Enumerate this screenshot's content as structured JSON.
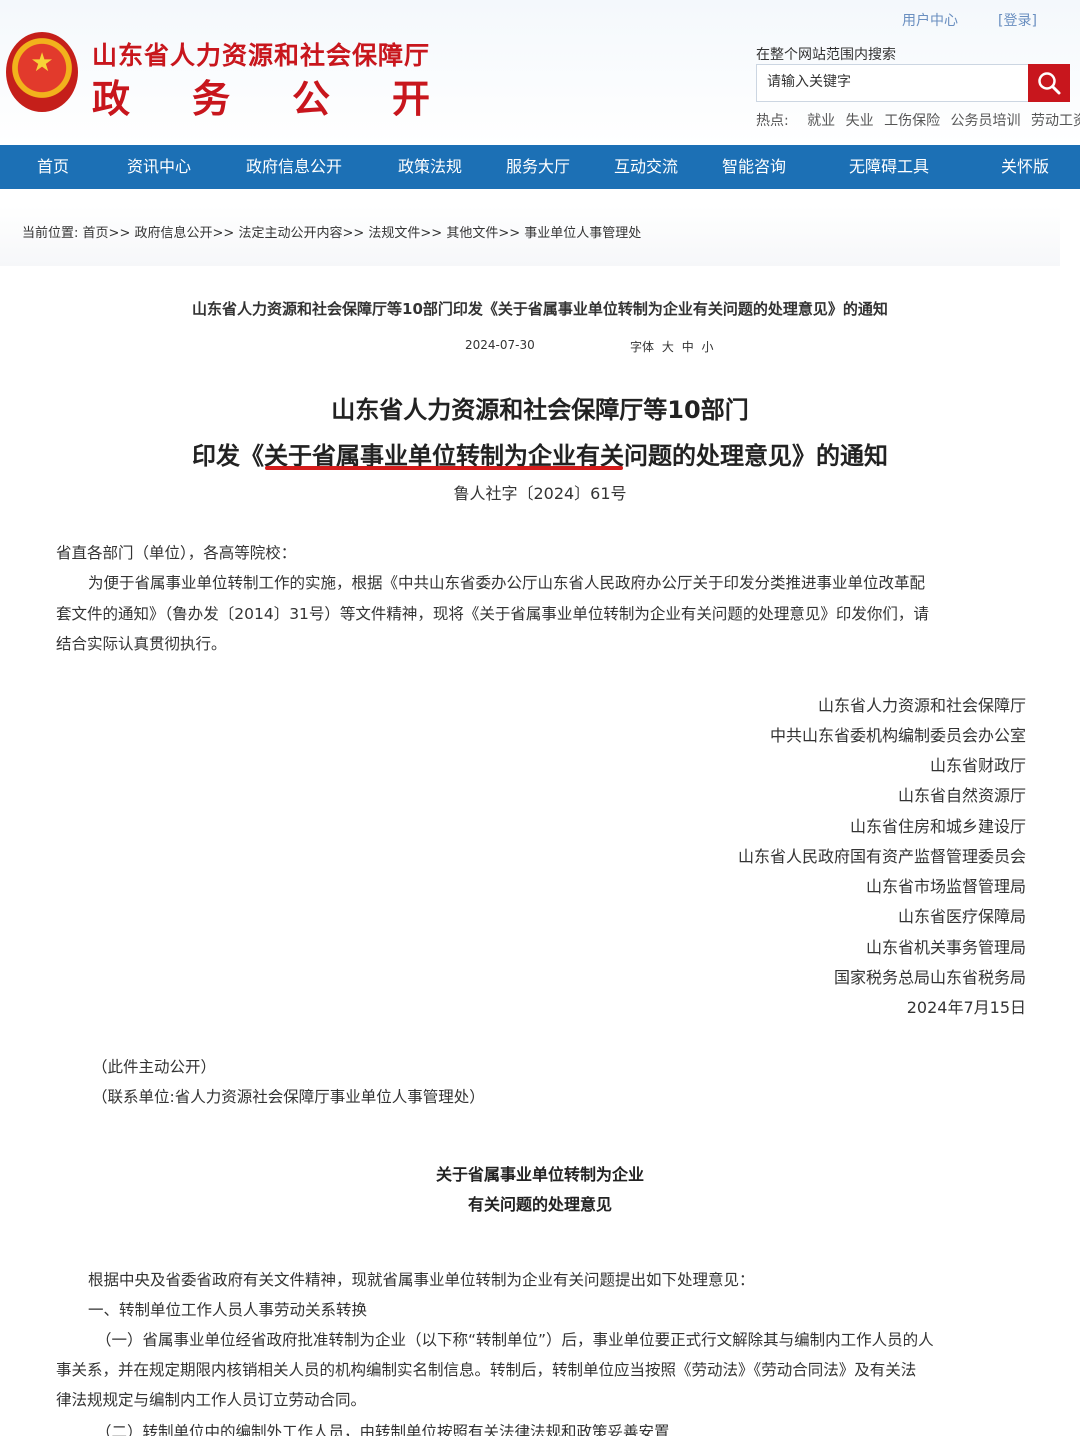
{
  "header": {
    "site_name": "山东省人力资源和社会保障厅",
    "site_sub": "政务公开",
    "user_center": "用户中心",
    "login": "[登录]",
    "search_label": "在整个网站范围内搜索",
    "search_placeholder": "请输入关键字",
    "hot_label": "热点:",
    "hot_keywords": [
      "就业",
      "失业",
      "工伤保险",
      "公务员培训",
      "劳动工资"
    ],
    "brand_color": "#c8161d"
  },
  "nav": {
    "bg_color": "#1c70b5",
    "items": [
      "首页",
      "资讯中心",
      "政府信息公开",
      "政策法规",
      "服务大厅",
      "互动交流",
      "智能咨询",
      "无障碍工具",
      "关怀版"
    ]
  },
  "breadcrumb": {
    "prefix": "当前位置:",
    "items": [
      "首页",
      "政府信息公开",
      "法定主动公开内容",
      "法规文件",
      "其他文件",
      "事业单位人事管理处"
    ],
    "separator": ">>"
  },
  "article": {
    "head_title": "山东省人力资源和社会保障厅等10部门印发《关于省属事业单位转制为企业有关问题的处理意见》的通知",
    "date": "2024-07-30",
    "font_label": "字体",
    "font_sizes": [
      "大",
      "中",
      "小"
    ],
    "title_line1": "山东省人力资源和社会保障厅等10部门",
    "title_line2": "印发《关于省属事业单位转制为企业有关问题的处理意见》的通知",
    "doc_no": "鲁人社字〔2024〕61号",
    "salutation": "省直各部门（单位），各高等院校：",
    "body_lines": [
      "为便于省属事业单位转制工作的实施，根据《中共山东省委办公厅山东省人民政府办公厅关于印发分类推进事业单位改革配",
      "套文件的通知》（鲁办发〔2014〕31号）等文件精神，现将《关于省属事业单位转制为企业有关问题的处理意见》印发你们，请",
      "结合实际认真贯彻执行。"
    ],
    "signatories": [
      "山东省人力资源和社会保障厅",
      "中共山东省委机构编制委员会办公室",
      "山东省财政厅",
      "山东省自然资源厅",
      "山东省住房和城乡建设厅",
      "山东省人民政府国有资产监督管理委员会",
      "山东省市场监督管理局",
      "山东省医疗保障局",
      "山东省机关事务管理局",
      "国家税务总局山东省税务局",
      "2024年7月15日"
    ],
    "note1": "（此件主动公开）",
    "note2": "（联系单位:省人力资源社会保障厅事业单位人事管理处）",
    "attach_title1": "关于省属事业单位转制为企业",
    "attach_title2": "有关问题的处理意见",
    "attach_intro": "根据中央及省委省政府有关文件精神，现就省属事业单位转制为企业有关问题提出如下处理意见：",
    "section1": "一、转制单位工作人员人事劳动关系转换",
    "para1_lines": [
      "（一）省属事业单位经省政府批准转制为企业（以下称“转制单位”）后，事业单位要正式行文解除其与编制内工作人员的人",
      "事关系，并在规定期限内核销相关人员的机构编制实名制信息。转制后，转制单位应当按照《劳动法》《劳动合同法》及有关法",
      "律法规规定与编制内工作人员订立劳动合同。"
    ],
    "para2_partial": "（二）转制单位中的编制外工作人员，由转制单位按照有关法律法规和政策妥善安置"
  }
}
